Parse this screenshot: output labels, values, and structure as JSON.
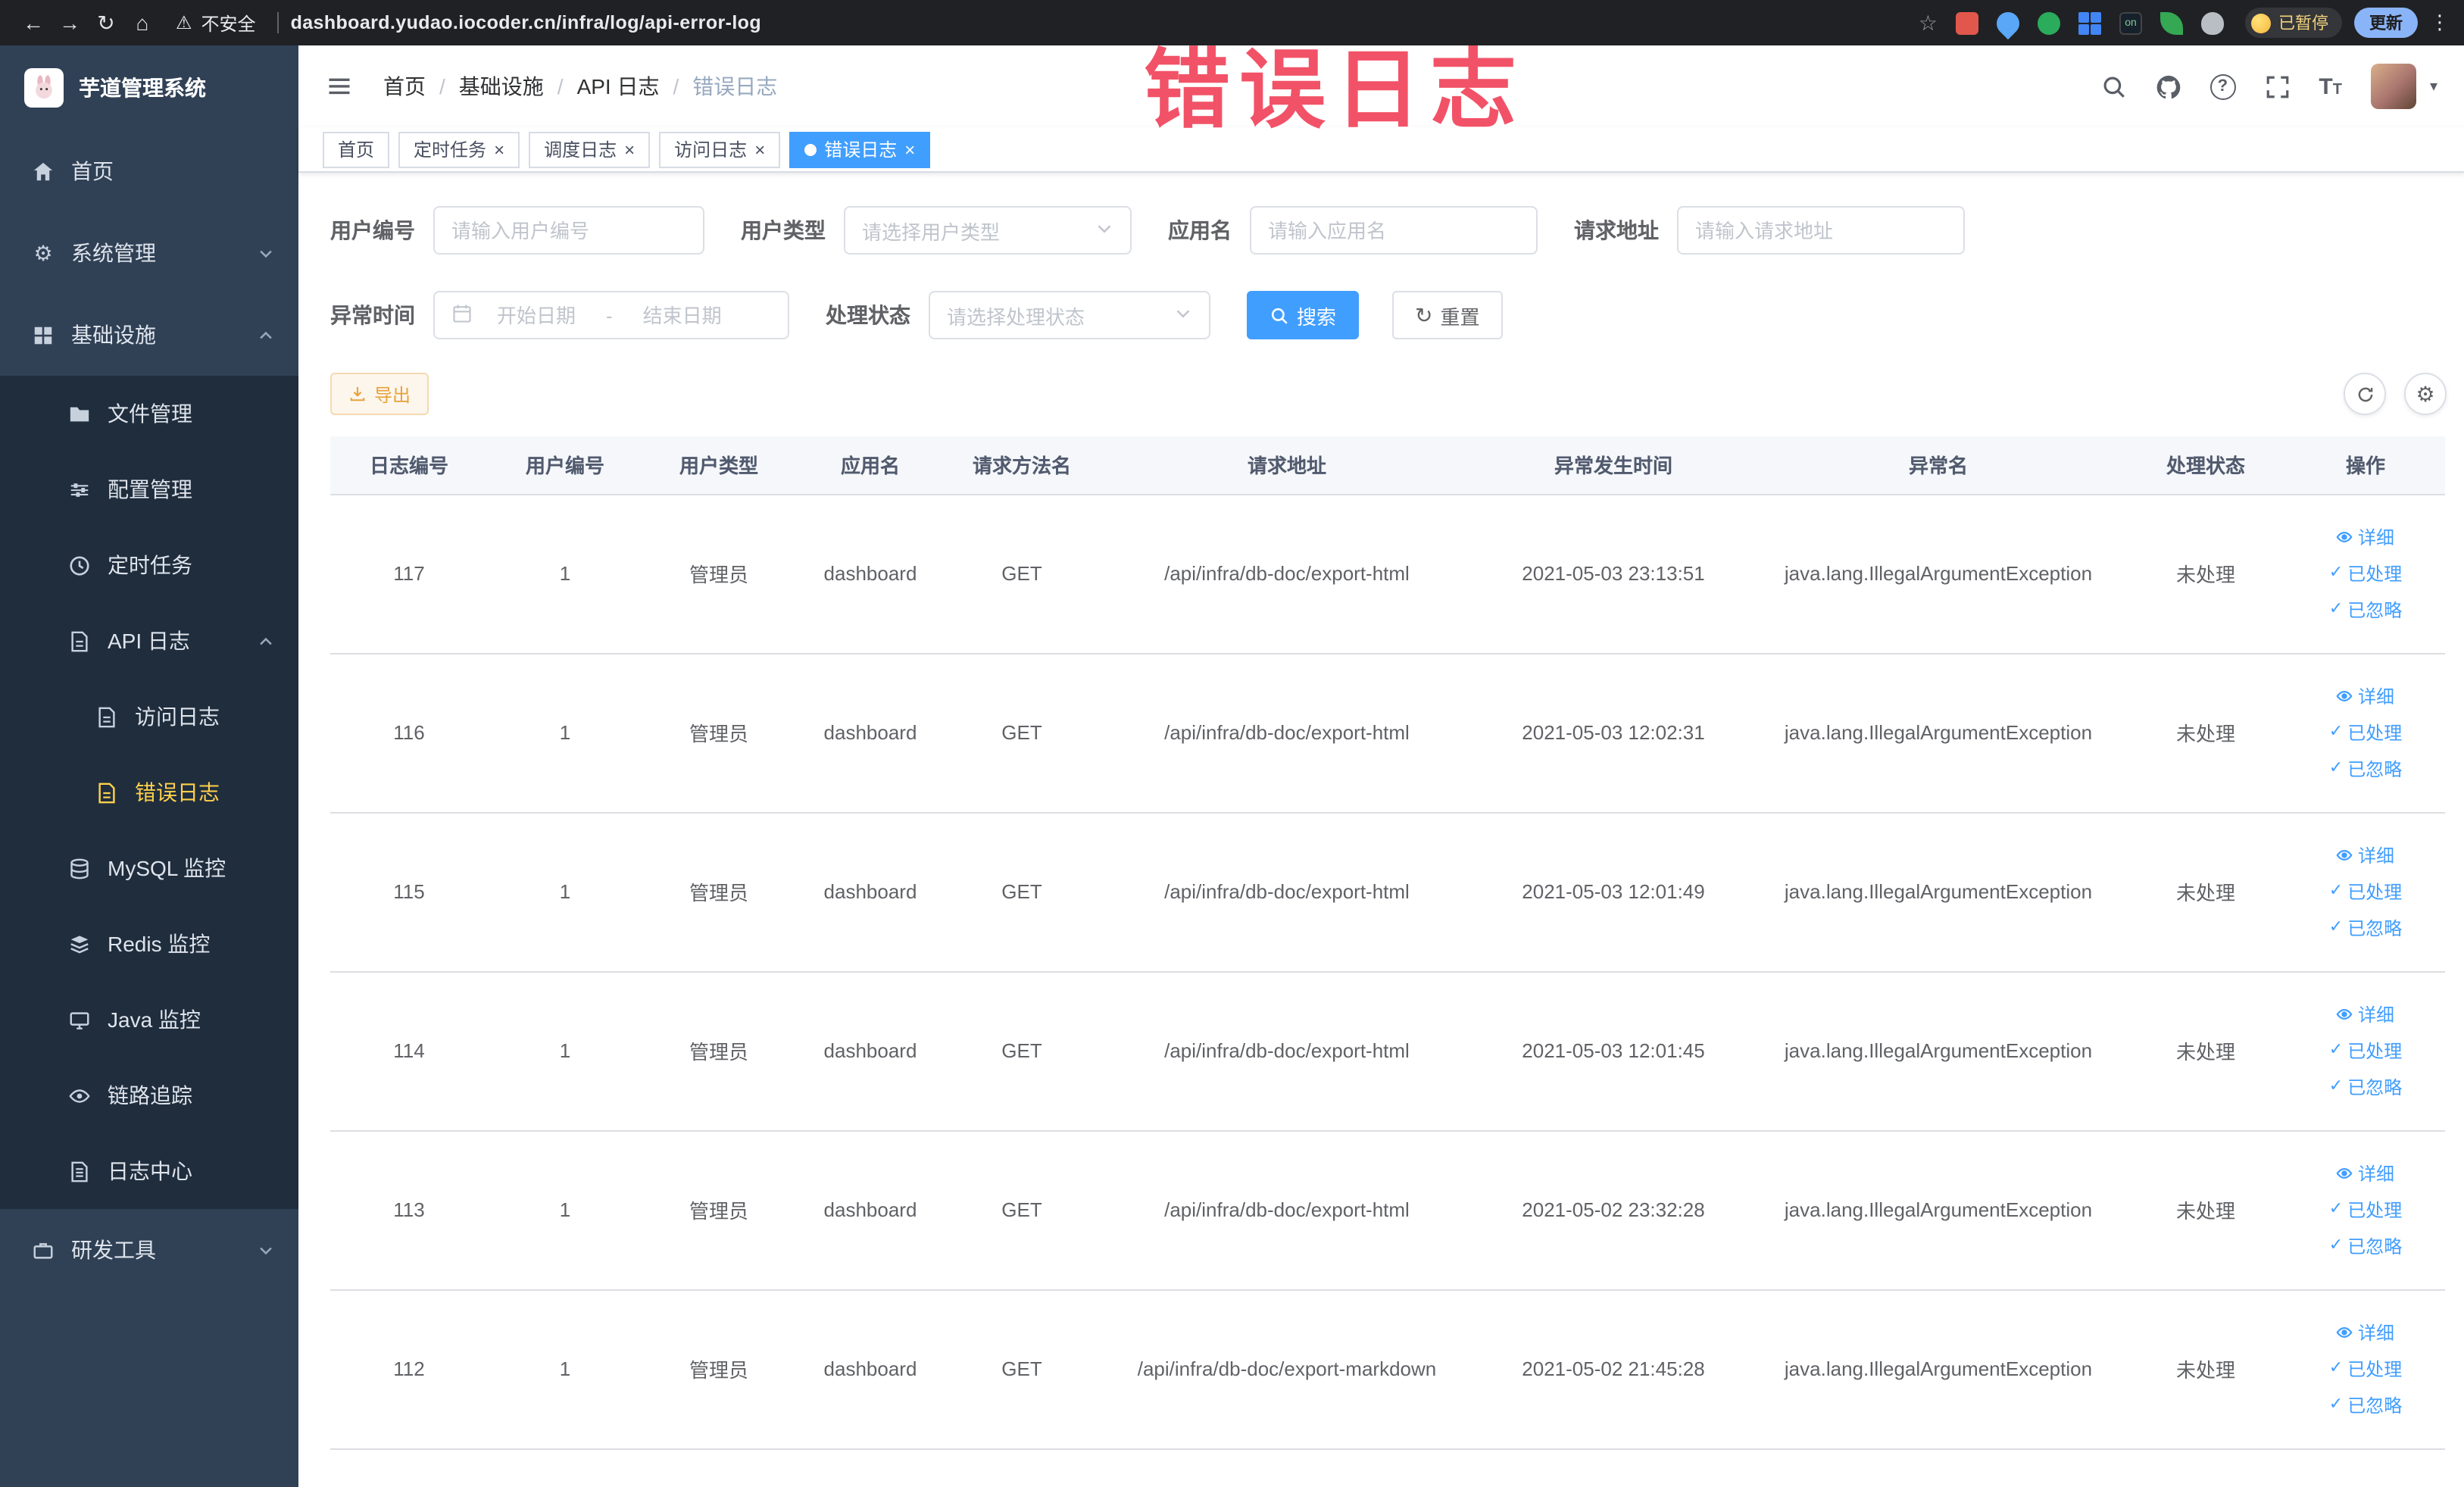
{
  "browser": {
    "security_label": "不安全",
    "url": "dashboard.yudao.iocoder.cn/infra/log/api-error-log",
    "paused_badge": "已暂停",
    "update_button": "更新",
    "extension_badge_on": "on"
  },
  "annotation": {
    "text": "错误日志"
  },
  "sidebar": {
    "logo_title": "芋道管理系统",
    "items": [
      {
        "label": "首页",
        "icon": "home-icon",
        "level": 1
      },
      {
        "label": "系统管理",
        "icon": "gear-icon",
        "level": 1,
        "state": "collapsed"
      },
      {
        "label": "基础设施",
        "icon": "grid-icon",
        "level": 1,
        "state": "expanded"
      },
      {
        "label": "文件管理",
        "icon": "folder-icon",
        "level": 2
      },
      {
        "label": "配置管理",
        "icon": "config-icon",
        "level": 2
      },
      {
        "label": "定时任务",
        "icon": "clock-icon",
        "level": 2
      },
      {
        "label": "API 日志",
        "icon": "api-log-icon",
        "level": 2,
        "state": "expanded"
      },
      {
        "label": "访问日志",
        "icon": "access-log-icon",
        "level": 3
      },
      {
        "label": "错误日志",
        "icon": "error-log-icon",
        "level": 3,
        "active": true
      },
      {
        "label": "MySQL 监控",
        "icon": "database-icon",
        "level": 2
      },
      {
        "label": "Redis 监控",
        "icon": "redis-icon",
        "level": 2
      },
      {
        "label": "Java 监控",
        "icon": "java-monitor-icon",
        "level": 2
      },
      {
        "label": "链路追踪",
        "icon": "trace-icon",
        "level": 2
      },
      {
        "label": "日志中心",
        "icon": "log-center-icon",
        "level": 2
      },
      {
        "label": "研发工具",
        "icon": "devtools-icon",
        "level": 1,
        "state": "collapsed"
      }
    ]
  },
  "header": {
    "breadcrumb": [
      "首页",
      "基础设施",
      "API 日志",
      "错误日志"
    ]
  },
  "tabs": [
    {
      "label": "首页",
      "closable": false,
      "active": false
    },
    {
      "label": "定时任务",
      "closable": true,
      "active": false
    },
    {
      "label": "调度日志",
      "closable": true,
      "active": false
    },
    {
      "label": "访问日志",
      "closable": true,
      "active": false
    },
    {
      "label": "错误日志",
      "closable": true,
      "active": true
    }
  ],
  "filters": {
    "user_id": {
      "label": "用户编号",
      "placeholder": "请输入用户编号"
    },
    "user_type": {
      "label": "用户类型",
      "placeholder": "请选择用户类型"
    },
    "app_name": {
      "label": "应用名",
      "placeholder": "请输入应用名"
    },
    "request_url": {
      "label": "请求地址",
      "placeholder": "请输入请求地址"
    },
    "exception_time": {
      "label": "异常时间",
      "start_placeholder": "开始日期",
      "separator": "-",
      "end_placeholder": "结束日期"
    },
    "process_status": {
      "label": "处理状态",
      "placeholder": "请选择处理状态"
    },
    "search_label": "搜索",
    "reset_label": "重置"
  },
  "toolbar": {
    "export_label": "导出"
  },
  "table": {
    "columns": [
      "日志编号",
      "用户编号",
      "用户类型",
      "应用名",
      "请求方法名",
      "请求地址",
      "异常发生时间",
      "异常名",
      "处理状态",
      "操作"
    ],
    "actions": [
      "详细",
      "已处理",
      "已忽略"
    ],
    "rows": [
      {
        "id": "117",
        "user_id": "1",
        "user_type": "管理员",
        "app": "dashboard",
        "method": "GET",
        "url": "/api/infra/db-doc/export-html",
        "time": "2021-05-03 23:13:51",
        "exception": "java.lang.IllegalArgumentException",
        "status": "未处理"
      },
      {
        "id": "116",
        "user_id": "1",
        "user_type": "管理员",
        "app": "dashboard",
        "method": "GET",
        "url": "/api/infra/db-doc/export-html",
        "time": "2021-05-03 12:02:31",
        "exception": "java.lang.IllegalArgumentException",
        "status": "未处理"
      },
      {
        "id": "115",
        "user_id": "1",
        "user_type": "管理员",
        "app": "dashboard",
        "method": "GET",
        "url": "/api/infra/db-doc/export-html",
        "time": "2021-05-03 12:01:49",
        "exception": "java.lang.IllegalArgumentException",
        "status": "未处理"
      },
      {
        "id": "114",
        "user_id": "1",
        "user_type": "管理员",
        "app": "dashboard",
        "method": "GET",
        "url": "/api/infra/db-doc/export-html",
        "time": "2021-05-03 12:01:45",
        "exception": "java.lang.IllegalArgumentException",
        "status": "未处理"
      },
      {
        "id": "113",
        "user_id": "1",
        "user_type": "管理员",
        "app": "dashboard",
        "method": "GET",
        "url": "/api/infra/db-doc/export-html",
        "time": "2021-05-02 23:32:28",
        "exception": "java.lang.IllegalArgumentException",
        "status": "未处理"
      },
      {
        "id": "112",
        "user_id": "1",
        "user_type": "管理员",
        "app": "dashboard",
        "method": "GET",
        "url": "/api/infra/db-doc/export-markdown",
        "time": "2021-05-02 21:45:28",
        "exception": "java.lang.IllegalArgumentException",
        "status": "未处理"
      }
    ]
  }
}
